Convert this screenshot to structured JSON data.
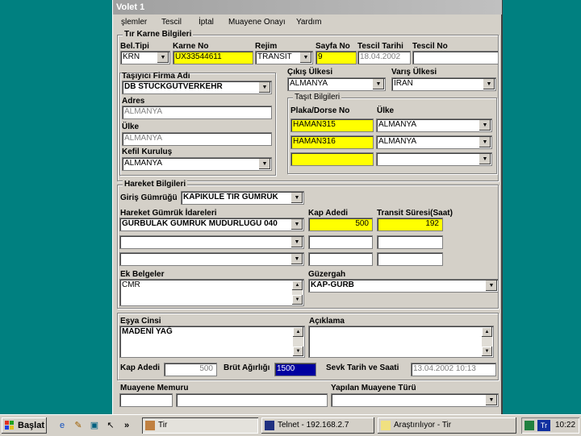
{
  "window": {
    "title": "Volet 1"
  },
  "menu": [
    "şlemler",
    "Tescil",
    "İptal",
    "Muayene Onayı",
    "Yardım"
  ],
  "tir_karne": {
    "group_title": "Tır Karne Bilgileri",
    "bel_tipi": {
      "label": "Bel.Tipi",
      "value": "KRN"
    },
    "karne_no": {
      "label": "Karne No",
      "value": "UX33544611"
    },
    "rejim": {
      "label": "Rejim",
      "value": "TRANSIT"
    },
    "sayfa_no": {
      "label": "Sayfa No",
      "value": "9"
    },
    "tescil_tarihi": {
      "label": "Tescil Tarihi",
      "value": "18.04.2002"
    },
    "tescil_no": {
      "label": "Tescil No",
      "value": ""
    }
  },
  "tasiyici": {
    "firma_label": "Taşıyıcı Firma Adı",
    "firma_value": "DB STUCKGUTVERKEHR",
    "adres_label": "Adres",
    "adres_value": "ALMANYA",
    "ulke_label": "Ülke",
    "ulke_value": "ALMANYA",
    "kefil_label": "Kefil Kuruluş",
    "kefil_value": "ALMANYA"
  },
  "cikis_ulkesi": {
    "label": "Çıkış Ülkesi",
    "value": "ALMANYA"
  },
  "varis_ulkesi": {
    "label": "Varış Ülkesi",
    "value": "İRAN"
  },
  "tasit": {
    "group_title": "Taşıt Bilgileri",
    "plaka_label": "Plaka/Dorse No",
    "ulke_label": "Ülke",
    "rows": [
      {
        "plaka": "HAMAN315",
        "ulke": "ALMANYA"
      },
      {
        "plaka": "HAMAN316",
        "ulke": "ALMANYA"
      },
      {
        "plaka": "",
        "ulke": ""
      }
    ]
  },
  "hareket": {
    "group_title": "Hareket Bilgileri",
    "giris_label": "Giriş Gümrüğü",
    "giris_value": "KAPIKULE TIR GÜMRÜK",
    "idare_label": "Hareket Gümrük İdareleri",
    "kap_label": "Kap Adedi",
    "transit_label": "Transit Süresi(Saat)",
    "rows": [
      {
        "idare": "GURBULAK GUMRUK MUDURLUGU 040",
        "kap": "500",
        "sure": "192"
      },
      {
        "idare": "",
        "kap": "",
        "sure": ""
      },
      {
        "idare": "",
        "kap": "",
        "sure": ""
      }
    ],
    "ek_label": "Ek Belgeler",
    "ek_value": "CMR",
    "guzergah_label": "Güzergah",
    "guzergah_value": "KAP-GURB"
  },
  "esya": {
    "cinsi_label": "Eşya Cinsi",
    "cinsi_value": "MADENİ YAĞ",
    "aciklama_label": "Açıklama",
    "aciklama_value": "",
    "kap_label": "Kap Adedi",
    "kap_value": "500",
    "brut_label": "Brüt Ağırlığı",
    "brut_value": "1500",
    "sevk_label": "Sevk Tarih ve Saati",
    "sevk_value": "13.04.2002 10:13"
  },
  "muayene": {
    "memuru_label": "Muayene Memuru",
    "tur_label": "Yapılan Muayene Türü"
  },
  "taskbar": {
    "start": "Başlat",
    "chevron": "»",
    "tasks": [
      "Tir",
      "Telnet - 192.168.2.7",
      "Araştırılıyor - Tir"
    ],
    "lang": "Tr",
    "clock": "10:22"
  }
}
